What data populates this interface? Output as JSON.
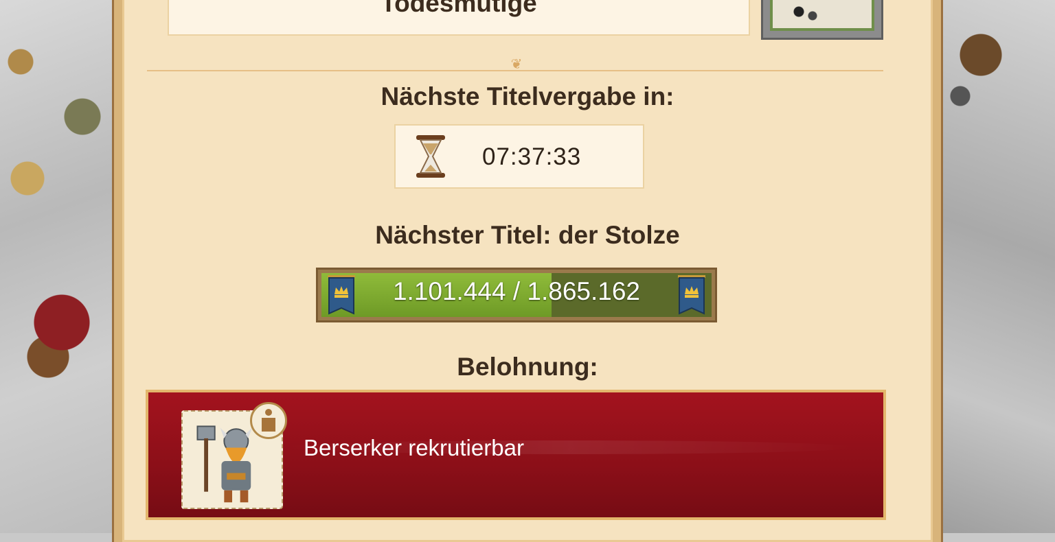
{
  "current_title": "Todesmutige",
  "next_award": {
    "heading": "Nächste Titelvergabe in:",
    "countdown": "07:37:33"
  },
  "next_title": {
    "heading": "Nächster Titel: der Stolze",
    "progress_text": "1.101.444 / 1.865.162",
    "progress_fraction": 0.5905
  },
  "reward": {
    "heading": "Belohnung:",
    "text": "Berserker rekrutierbar",
    "unit_icon": "berserker-viking-icon",
    "info_icon": "info-icon"
  },
  "colors": {
    "progress_fill": "#7eab30",
    "reward_banner": "#9a121c",
    "parchment": "#f6e3c0"
  }
}
